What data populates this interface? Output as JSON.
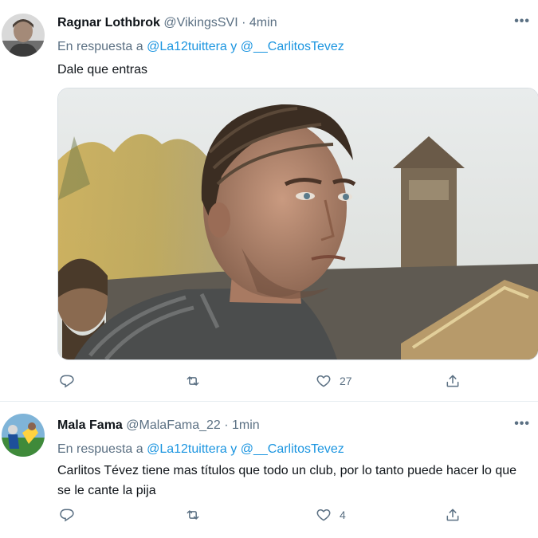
{
  "tweets": [
    {
      "name": "Ragnar Lothbrok",
      "handle": "@VikingsSVI",
      "separator": "·",
      "time": "4min",
      "reply_prefix": "En respuesta a",
      "mention1": "@La12tuittera",
      "conjunction": "y",
      "mention2": "@__CarlitosTevez",
      "text": "Dale que entras",
      "reply_count": "",
      "retweet_count": "",
      "like_count": "27",
      "more": "•••"
    },
    {
      "name": "Mala Fama",
      "handle": "@MalaFama_22",
      "separator": "·",
      "time": "1min",
      "reply_prefix": "En respuesta a",
      "mention1": "@La12tuittera",
      "conjunction": "y",
      "mention2": "@__CarlitosTevez",
      "text": "Carlitos Tévez tiene mas títulos que todo un club, por lo tanto puede hacer lo que se le cante la pija",
      "reply_count": "",
      "retweet_count": "",
      "like_count": "4",
      "more": "•••"
    }
  ],
  "icons": {
    "reply": "reply-icon",
    "retweet": "retweet-icon",
    "like": "heart-icon",
    "share": "share-icon",
    "more": "more-icon"
  },
  "colors": {
    "text": "#0f1419",
    "secondary": "#5b7083",
    "link": "#1b95e0",
    "border": "#e6ecf0"
  }
}
